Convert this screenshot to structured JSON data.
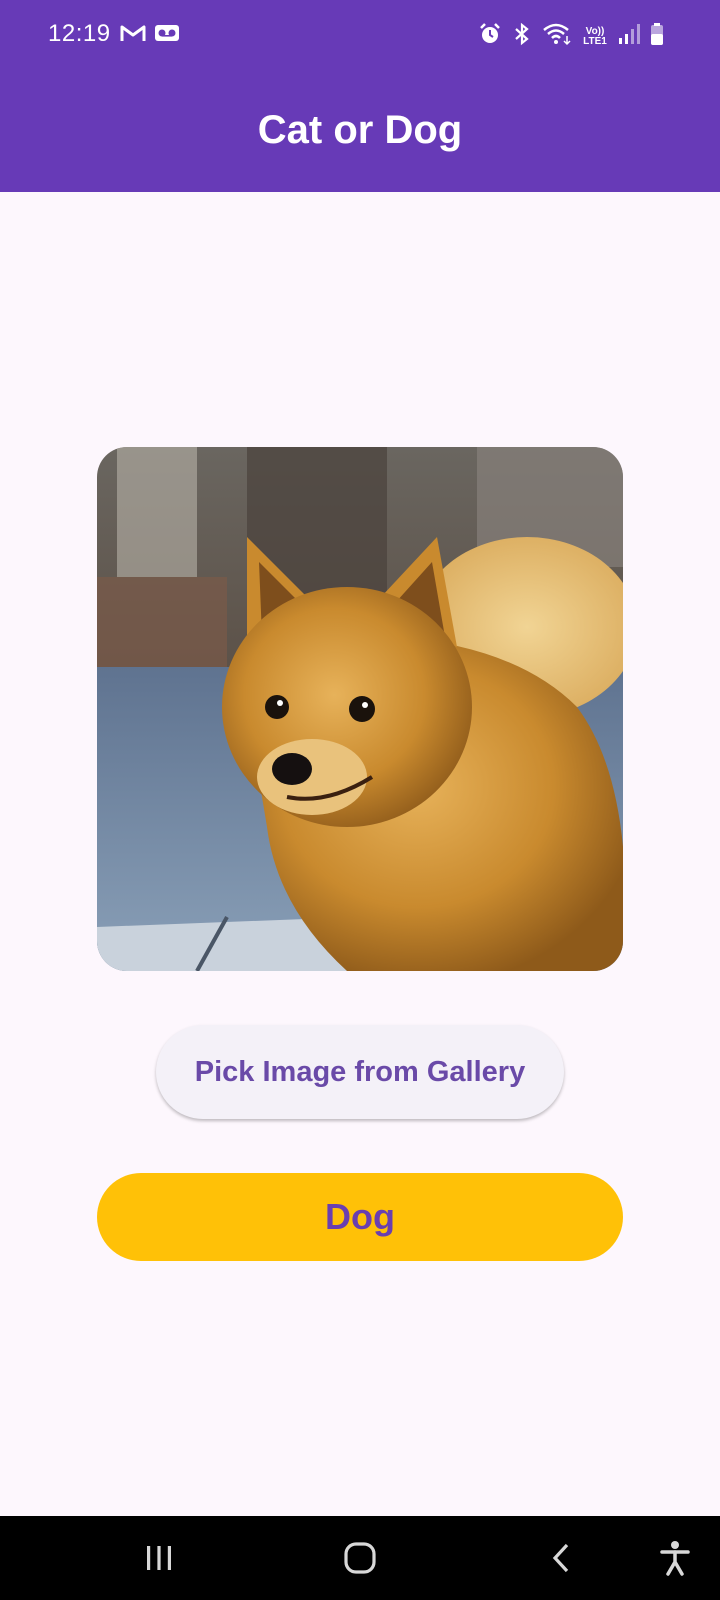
{
  "status_bar": {
    "time": "12:19",
    "icons_left": [
      "gmail-icon",
      "voicemail-icon"
    ],
    "icons_right": [
      "alarm-icon",
      "bluetooth-icon",
      "wifi-icon",
      "volte-icon",
      "signal-icon",
      "battery-icon"
    ],
    "volte_top": "Vo))",
    "volte_bottom": "LTE1"
  },
  "app_bar": {
    "title": "Cat or Dog",
    "color": "#673ab7"
  },
  "main": {
    "image": {
      "description_icon": "dog-photo"
    },
    "pick_button_label": "Pick Image from Gallery",
    "result_label": "Dog",
    "result_color": "#ffc107"
  },
  "nav_bar": {
    "items": [
      "recents-icon",
      "home-icon",
      "back-icon",
      "accessibility-icon"
    ]
  }
}
